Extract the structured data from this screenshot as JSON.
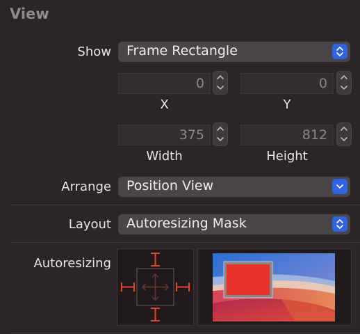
{
  "section": {
    "title": "View"
  },
  "show": {
    "label": "Show",
    "value": "Frame Rectangle"
  },
  "position": {
    "x": {
      "value": "0",
      "caption": "X"
    },
    "y": {
      "value": "0",
      "caption": "Y"
    }
  },
  "size": {
    "width": {
      "value": "375",
      "caption": "Width"
    },
    "height": {
      "value": "812",
      "caption": "Height"
    }
  },
  "arrange": {
    "label": "Arrange",
    "value": "Position View"
  },
  "layout": {
    "label": "Layout",
    "value": "Autoresizing Mask"
  },
  "autoresizing": {
    "label": "Autoresizing"
  },
  "colors": {
    "accent": "#2f63e3",
    "strut": "#e4432f",
    "preview_view": "#e8322a"
  }
}
